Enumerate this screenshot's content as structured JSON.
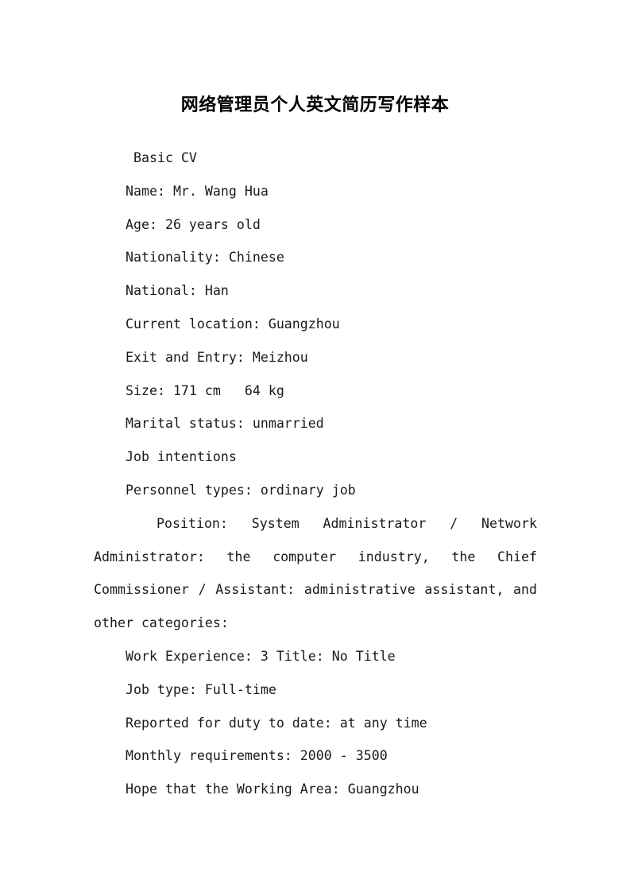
{
  "document": {
    "title": "网络管理员个人英文简历写作样本",
    "section_heading": "Basic CV",
    "basic_info": [
      "Name: Mr. Wang Hua",
      "Age: 26 years old",
      "Nationality: Chinese",
      "National: Han",
      "Current location: Guangzhou",
      "Exit and Entry: Meizhou",
      "Size: 171 cm   64 kg",
      "Marital status: unmarried"
    ],
    "job_intentions_heading": "Job intentions",
    "personnel_types": "Personnel types: ordinary job",
    "position_paragraph": "Position:  System  Administrator  /  Network Administrator:  the  computer  industry,  the  Chief Commissioner / Assistant: administrative assistant, and other categories:",
    "job_details": [
      "Work Experience: 3 Title: No Title",
      "Job type: Full-time",
      "Reported for duty to date: at any time",
      "Monthly requirements: 2000 - 3500",
      "Hope that the Working Area: Guangzhou"
    ]
  },
  "style": {
    "page_background": "#ffffff",
    "text_color": "#1a1a1a",
    "title_color": "#000000"
  }
}
